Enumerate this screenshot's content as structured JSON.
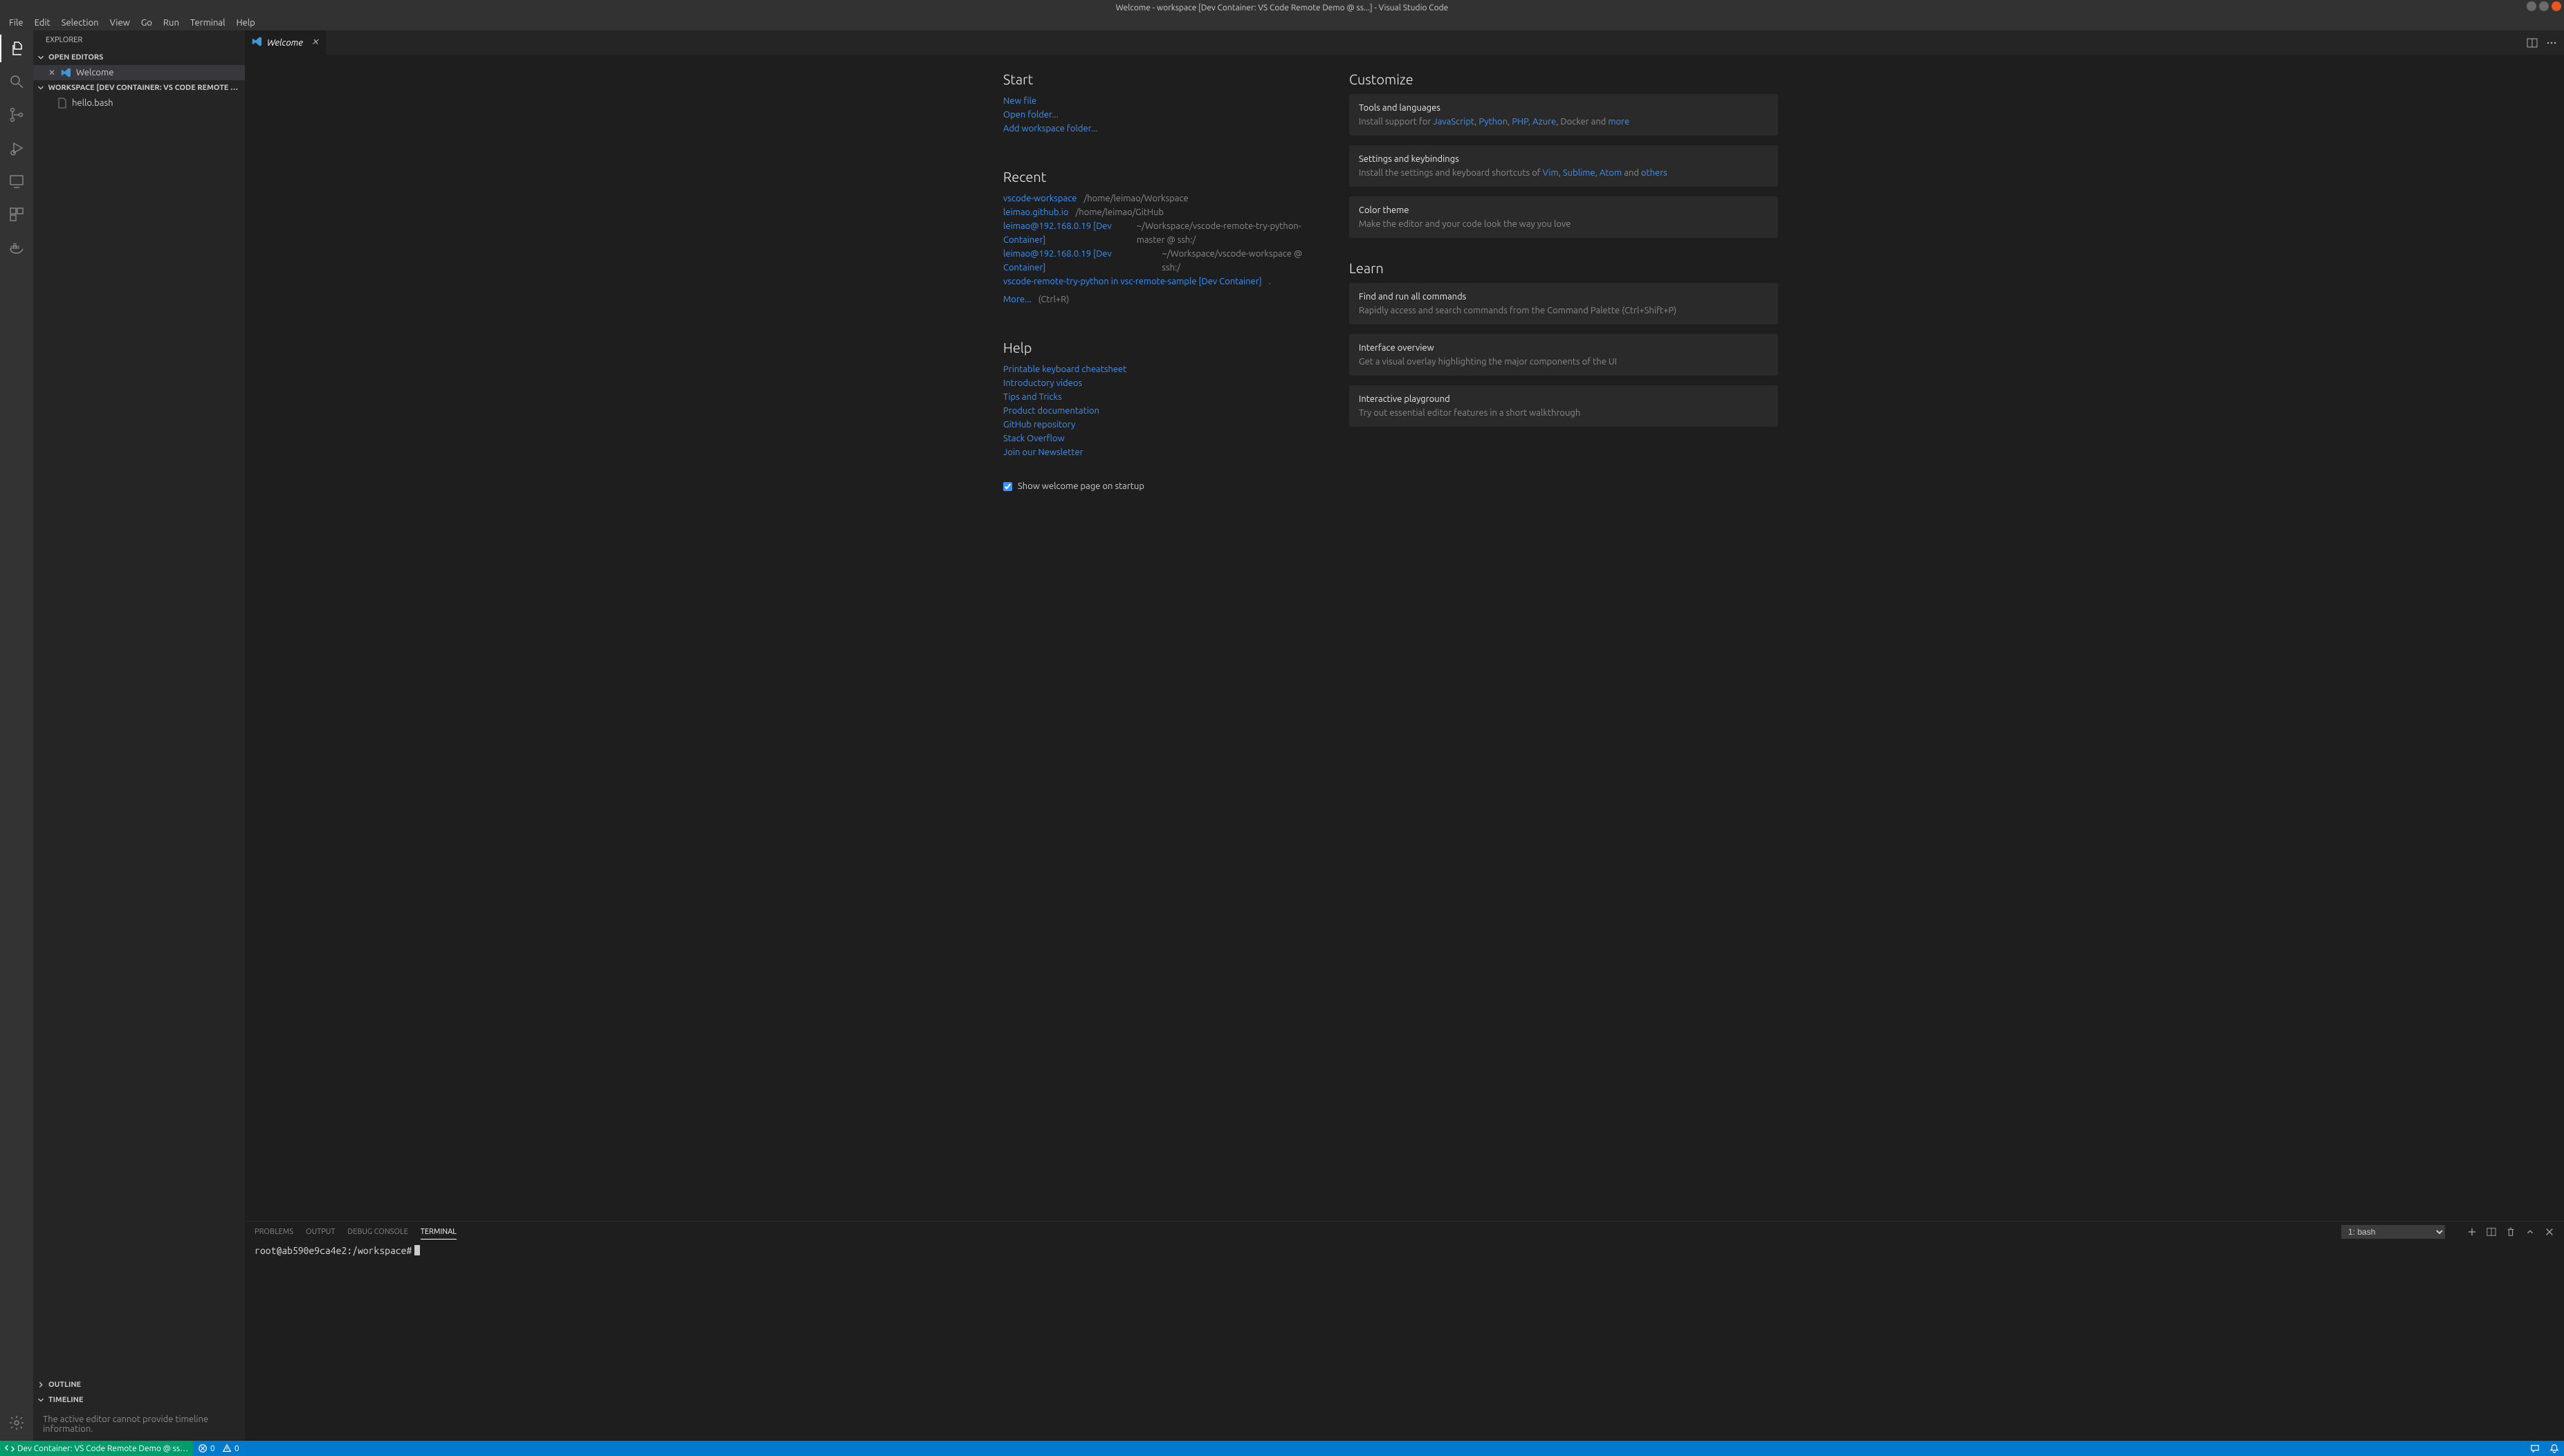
{
  "title": "Welcome - workspace [Dev Container: VS Code Remote Demo @ ss...] - Visual Studio Code",
  "menu": [
    "File",
    "Edit",
    "Selection",
    "View",
    "Go",
    "Run",
    "Terminal",
    "Help"
  ],
  "sidebar": {
    "title": "Explorer",
    "open_editors": {
      "header": "Open Editors",
      "items": [
        {
          "label": "Welcome"
        }
      ]
    },
    "workspace": {
      "header": "Workspace [Dev Container: VS Code Remote De…",
      "files": [
        {
          "name": "hello.bash"
        }
      ]
    },
    "outline": {
      "header": "Outline"
    },
    "timeline": {
      "header": "Timeline",
      "message": "The active editor cannot provide timeline information."
    }
  },
  "tab": {
    "label": "Welcome"
  },
  "welcome": {
    "start": {
      "title": "Start",
      "new_file": "New file",
      "open_folder": "Open folder...",
      "add_workspace": "Add workspace folder..."
    },
    "recent": {
      "title": "Recent",
      "items": [
        {
          "name": "vscode-workspace",
          "path": "/home/leimao/Workspace"
        },
        {
          "name": "leimao.github.io",
          "path": "/home/leimao/GitHub"
        },
        {
          "name": "leimao@192.168.0.19 [Dev Container]",
          "path": "~/Workspace/vscode-remote-try-python-master @ ssh:/"
        },
        {
          "name": "leimao@192.168.0.19 [Dev Container]",
          "path": "~/Workspace/vscode-workspace @ ssh:/"
        },
        {
          "name": "vscode-remote-try-python in vsc-remote-sample [Dev Container]",
          "path": "."
        }
      ],
      "more": "More...",
      "more_hint": "(Ctrl+R)"
    },
    "help": {
      "title": "Help",
      "links": [
        "Printable keyboard cheatsheet",
        "Introductory videos",
        "Tips and Tricks",
        "Product documentation",
        "GitHub repository",
        "Stack Overflow",
        "Join our Newsletter"
      ]
    },
    "show_startup": "Show welcome page on startup",
    "customize": {
      "title": "Customize",
      "tools": {
        "title": "Tools and languages",
        "prefix": "Install support for ",
        "langs": [
          "JavaScript",
          "Python",
          "PHP",
          "Azure"
        ],
        "suffix1": ", Docker and ",
        "more": "more"
      },
      "settings": {
        "title": "Settings and keybindings",
        "prefix": "Install the settings and keyboard shortcuts of ",
        "editors": [
          "Vim",
          "Sublime",
          "Atom"
        ],
        "suffix": " and ",
        "others": "others"
      },
      "theme": {
        "title": "Color theme",
        "desc": "Make the editor and your code look the way you love"
      }
    },
    "learn": {
      "title": "Learn",
      "commands": {
        "title": "Find and run all commands",
        "desc": "Rapidly access and search commands from the Command Palette (Ctrl+Shift+P)"
      },
      "overview": {
        "title": "Interface overview",
        "desc": "Get a visual overlay highlighting the major components of the UI"
      },
      "playground": {
        "title": "Interactive playground",
        "desc": "Try out essential editor features in a short walkthrough"
      }
    }
  },
  "panel": {
    "tabs": [
      "Problems",
      "Output",
      "Debug Console",
      "Terminal"
    ],
    "active_tab": "Terminal",
    "term_selector": "1: bash",
    "prompt": "root@ab590e9ca4e2:/workspace#"
  },
  "status": {
    "remote": "Dev Container: VS Code Remote Demo @ ss…",
    "errors": "0",
    "warnings": "0"
  }
}
